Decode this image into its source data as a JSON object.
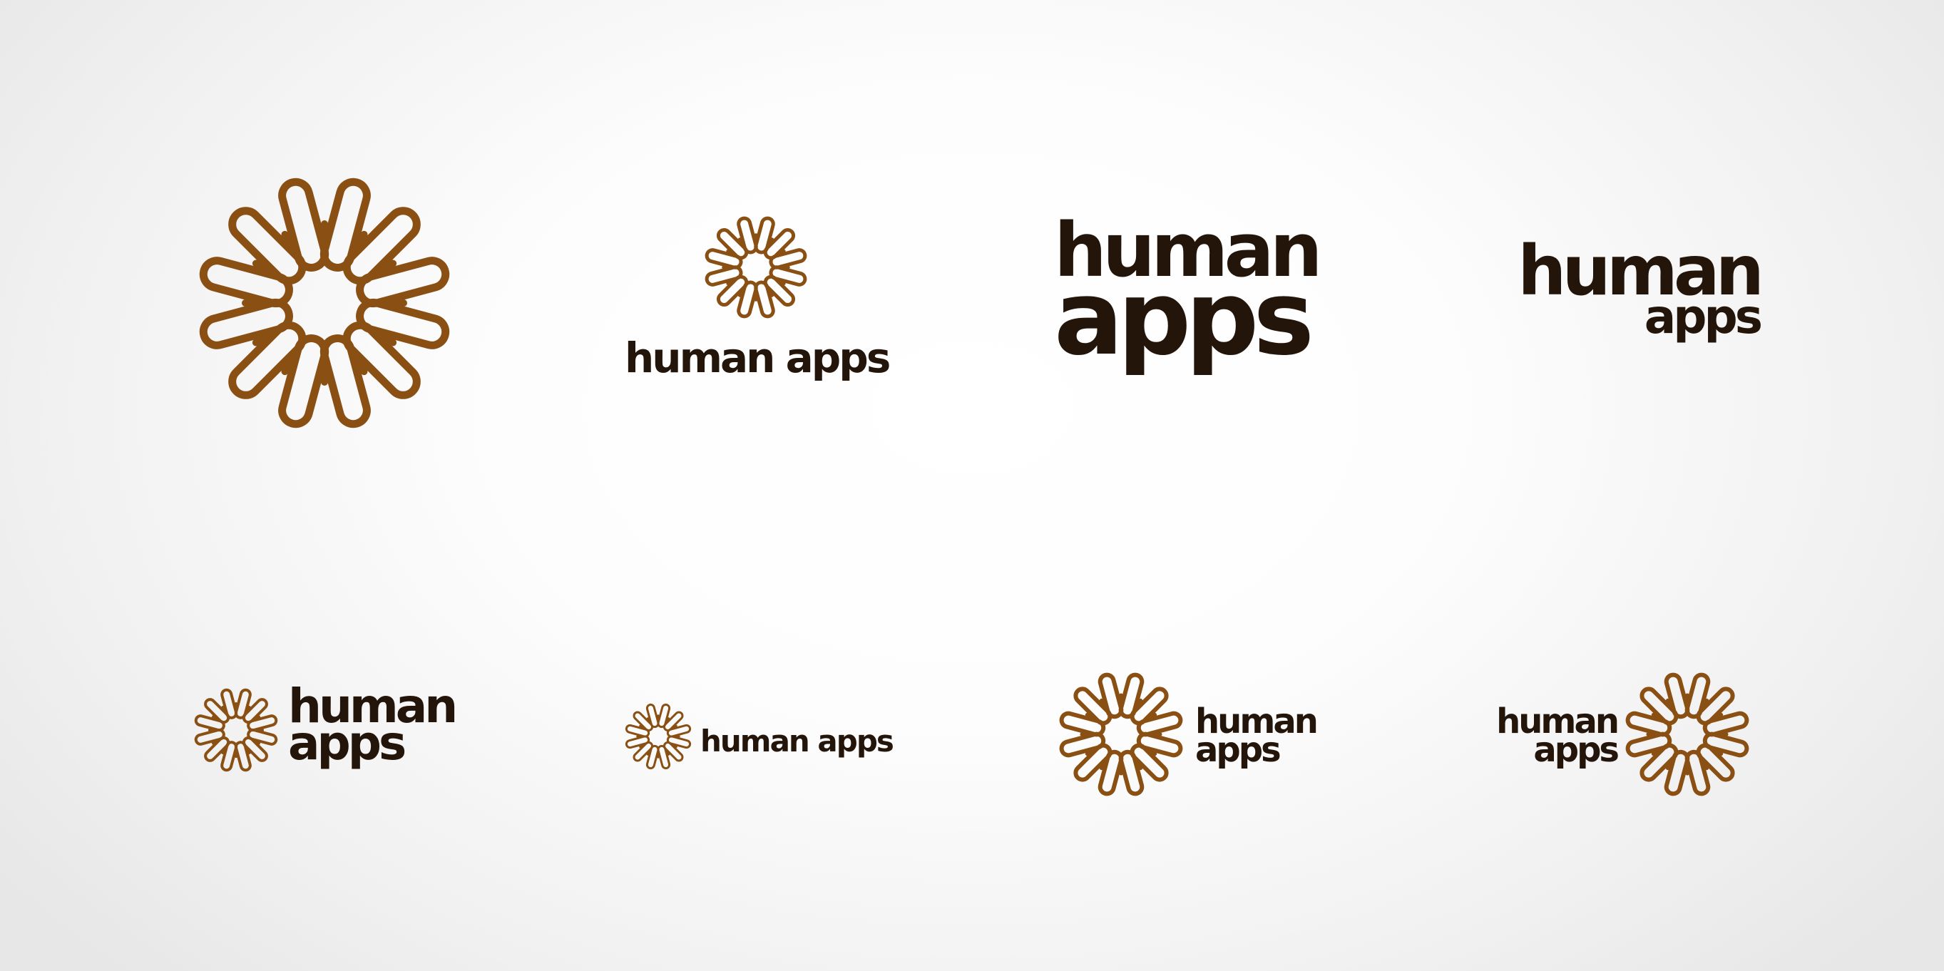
{
  "colors": {
    "mark": "#8a4f12",
    "wordmark": "#24150b",
    "background": "#ffffff"
  },
  "brand": {
    "word1": "human",
    "word2": "apps",
    "full": "human apps"
  },
  "variants": [
    {
      "id": "symbol-only",
      "icon": "sunburst-icon",
      "layout": "symbol"
    },
    {
      "id": "symbol-above-wordmark",
      "icon": "sunburst-icon",
      "layout": "stacked-center"
    },
    {
      "id": "wordmark-stacked-large",
      "icon": "",
      "layout": "wordmark-two-line"
    },
    {
      "id": "wordmark-stacked-right",
      "icon": "",
      "layout": "wordmark-two-line-right"
    },
    {
      "id": "symbol-left-wordmark-stacked",
      "icon": "sunburst-icon",
      "layout": "inline-left"
    },
    {
      "id": "symbol-left-wordmark-single",
      "icon": "sunburst-icon",
      "layout": "inline-left-single"
    },
    {
      "id": "symbol-left-wordmark-stacked-small",
      "icon": "sunburst-icon",
      "layout": "inline-left"
    },
    {
      "id": "wordmark-left-symbol-right",
      "icon": "sunburst-icon",
      "layout": "inline-right"
    }
  ]
}
